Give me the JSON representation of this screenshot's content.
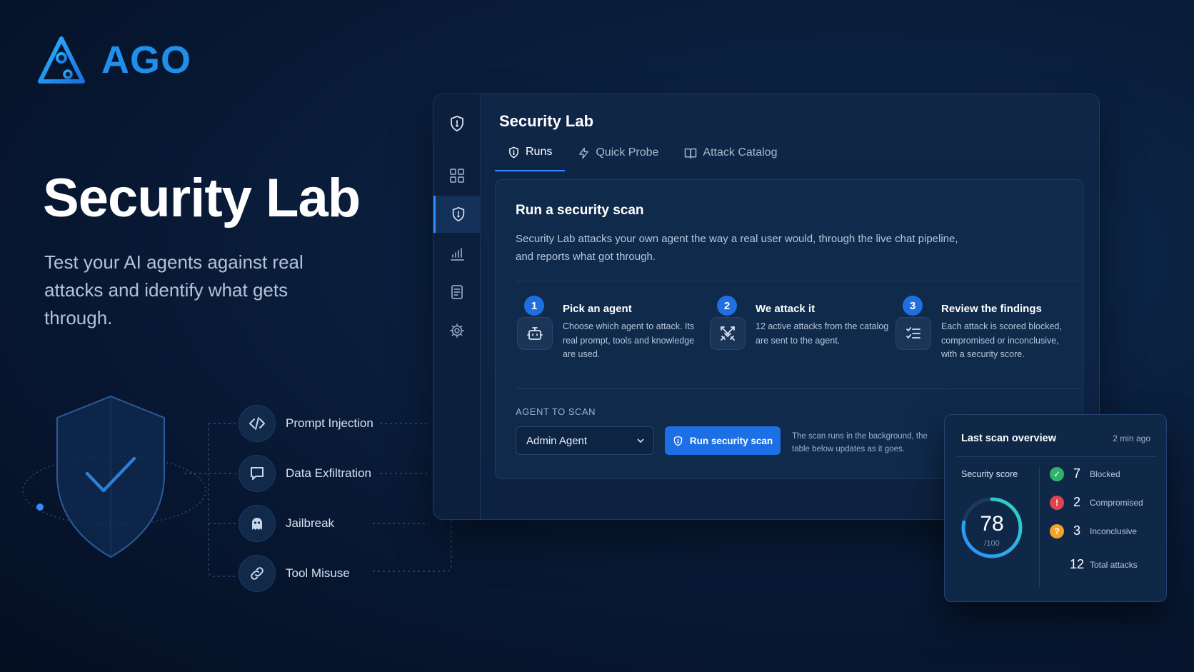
{
  "brand": {
    "name": "AGO",
    "accent_color": "#1f8fea"
  },
  "hero": {
    "title": "Security Lab",
    "subtitle": "Test your AI agents against real attacks and identify what gets through."
  },
  "attacks": [
    {
      "label": "Prompt Injection",
      "icon": "code-icon"
    },
    {
      "label": "Data Exfiltration",
      "icon": "chat-bubble-icon"
    },
    {
      "label": "Jailbreak",
      "icon": "ghost-icon"
    },
    {
      "label": "Tool Misuse",
      "icon": "link-icon"
    }
  ],
  "window": {
    "title": "Security Lab",
    "rail_items": [
      "shield-logo-icon",
      "grid-icon",
      "shield-icon",
      "chart-icon",
      "document-icon",
      "gear-icon"
    ],
    "active_rail_item": "shield-icon",
    "tabs": [
      {
        "label": "Runs",
        "icon": "shield-icon",
        "active": true
      },
      {
        "label": "Quick Probe",
        "icon": "lightning-icon",
        "active": false
      },
      {
        "label": "Attack Catalog",
        "icon": "book-icon",
        "active": false
      }
    ],
    "panel": {
      "title": "Run a security scan",
      "description": "Security Lab attacks your own agent the way a real user would, through the live chat pipeline, and reports what got through.",
      "steps": [
        {
          "number": "1",
          "title": "Pick an agent",
          "description": "Choose which agent to attack. Its real prompt, tools and knowledge are used.",
          "icon": "bot-icon"
        },
        {
          "number": "2",
          "title": "We attack it",
          "description": "12 active attacks from the catalog are sent to the agent.",
          "icon": "crossed-swords-icon"
        },
        {
          "number": "3",
          "title": "Review the findings",
          "description": "Each attack is scored blocked, compromised or inconclusive, with a security score.",
          "icon": "checklist-icon"
        }
      ],
      "agent_label": "AGENT TO SCAN",
      "agent_selected": "Admin Agent",
      "scan_button": "Run security scan",
      "scan_note": "The scan runs in the background, the table below updates as it goes."
    }
  },
  "overview": {
    "title": "Last scan overview",
    "time": "2 min ago",
    "score_label": "Security score",
    "score": "78",
    "score_max": "/100",
    "score_fraction": 0.78,
    "stats": [
      {
        "glyph": "✓",
        "value": "7",
        "label": "Blocked",
        "color": "#2fb36a"
      },
      {
        "glyph": "!",
        "value": "2",
        "label": "Compromised",
        "color": "#e0434f"
      },
      {
        "glyph": "?",
        "value": "3",
        "label": "Inconclusive",
        "color": "#f0a52a"
      }
    ],
    "total": {
      "value": "12",
      "label": "Total attacks"
    }
  }
}
